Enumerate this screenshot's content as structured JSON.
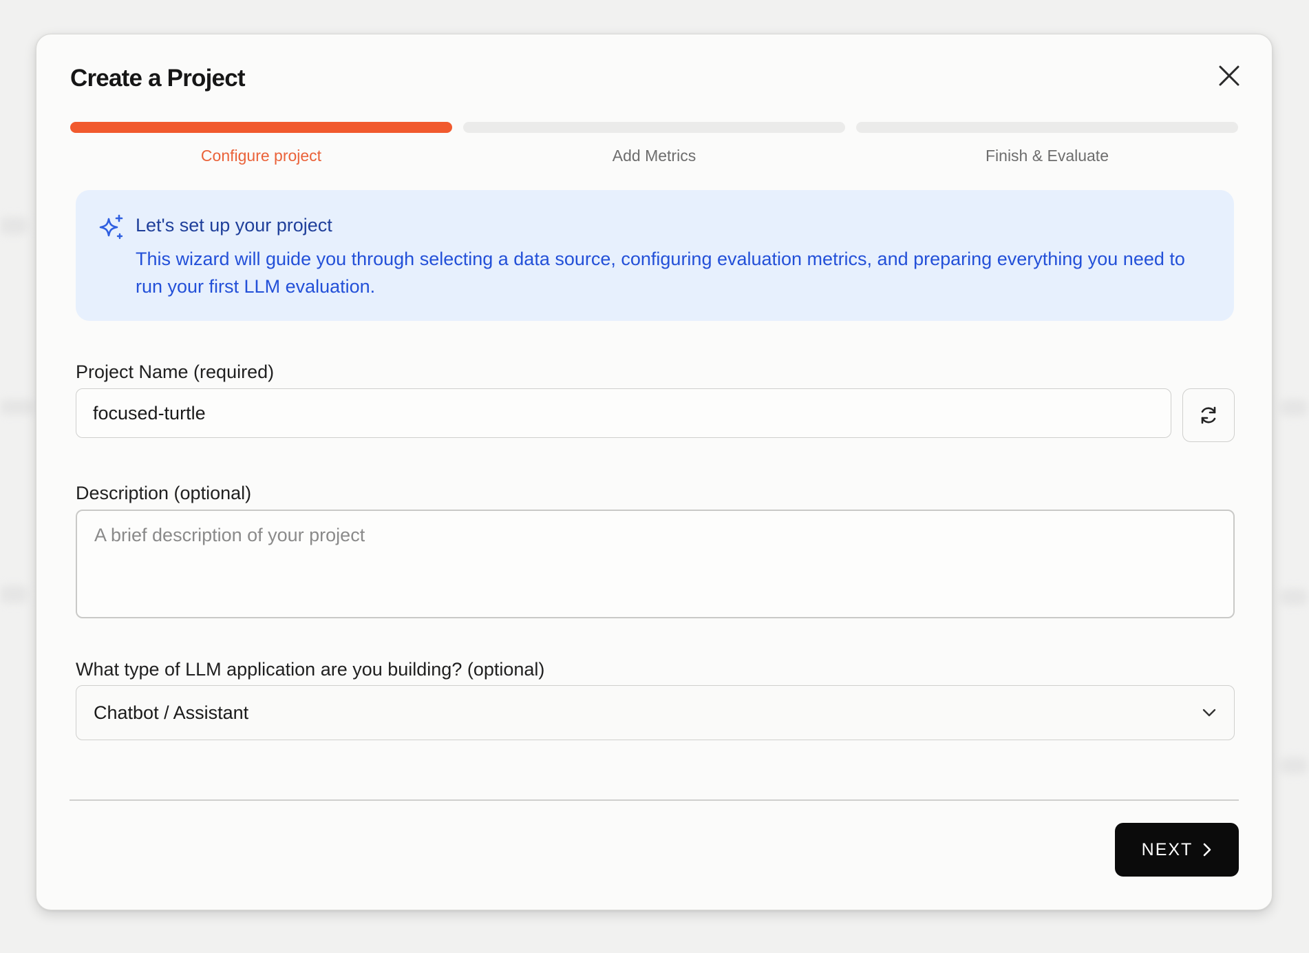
{
  "modal": {
    "title": "Create a Project"
  },
  "stepper": {
    "steps": [
      {
        "label": "Configure project",
        "active": true
      },
      {
        "label": "Add Metrics",
        "active": false
      },
      {
        "label": "Finish & Evaluate",
        "active": false
      }
    ]
  },
  "info": {
    "title": "Let's set up your project",
    "text": "This wizard will guide you through selecting a data source, configuring evaluation metrics, and preparing everything you need to run your first LLM evaluation."
  },
  "form": {
    "project_name_label": "Project Name (required)",
    "project_name_value": "focused-turtle",
    "description_label": "Description (optional)",
    "description_value": "",
    "description_placeholder": "A brief description of your project",
    "app_type_label": "What type of LLM application are you building? (optional)",
    "app_type_value": "Chatbot / Assistant"
  },
  "footer": {
    "next_label": "NEXT"
  },
  "colors": {
    "accent": "#f15a2e",
    "info_bg": "#e7f0fd",
    "info_text": "#2350d8",
    "button_bg": "#0b0b0b"
  }
}
